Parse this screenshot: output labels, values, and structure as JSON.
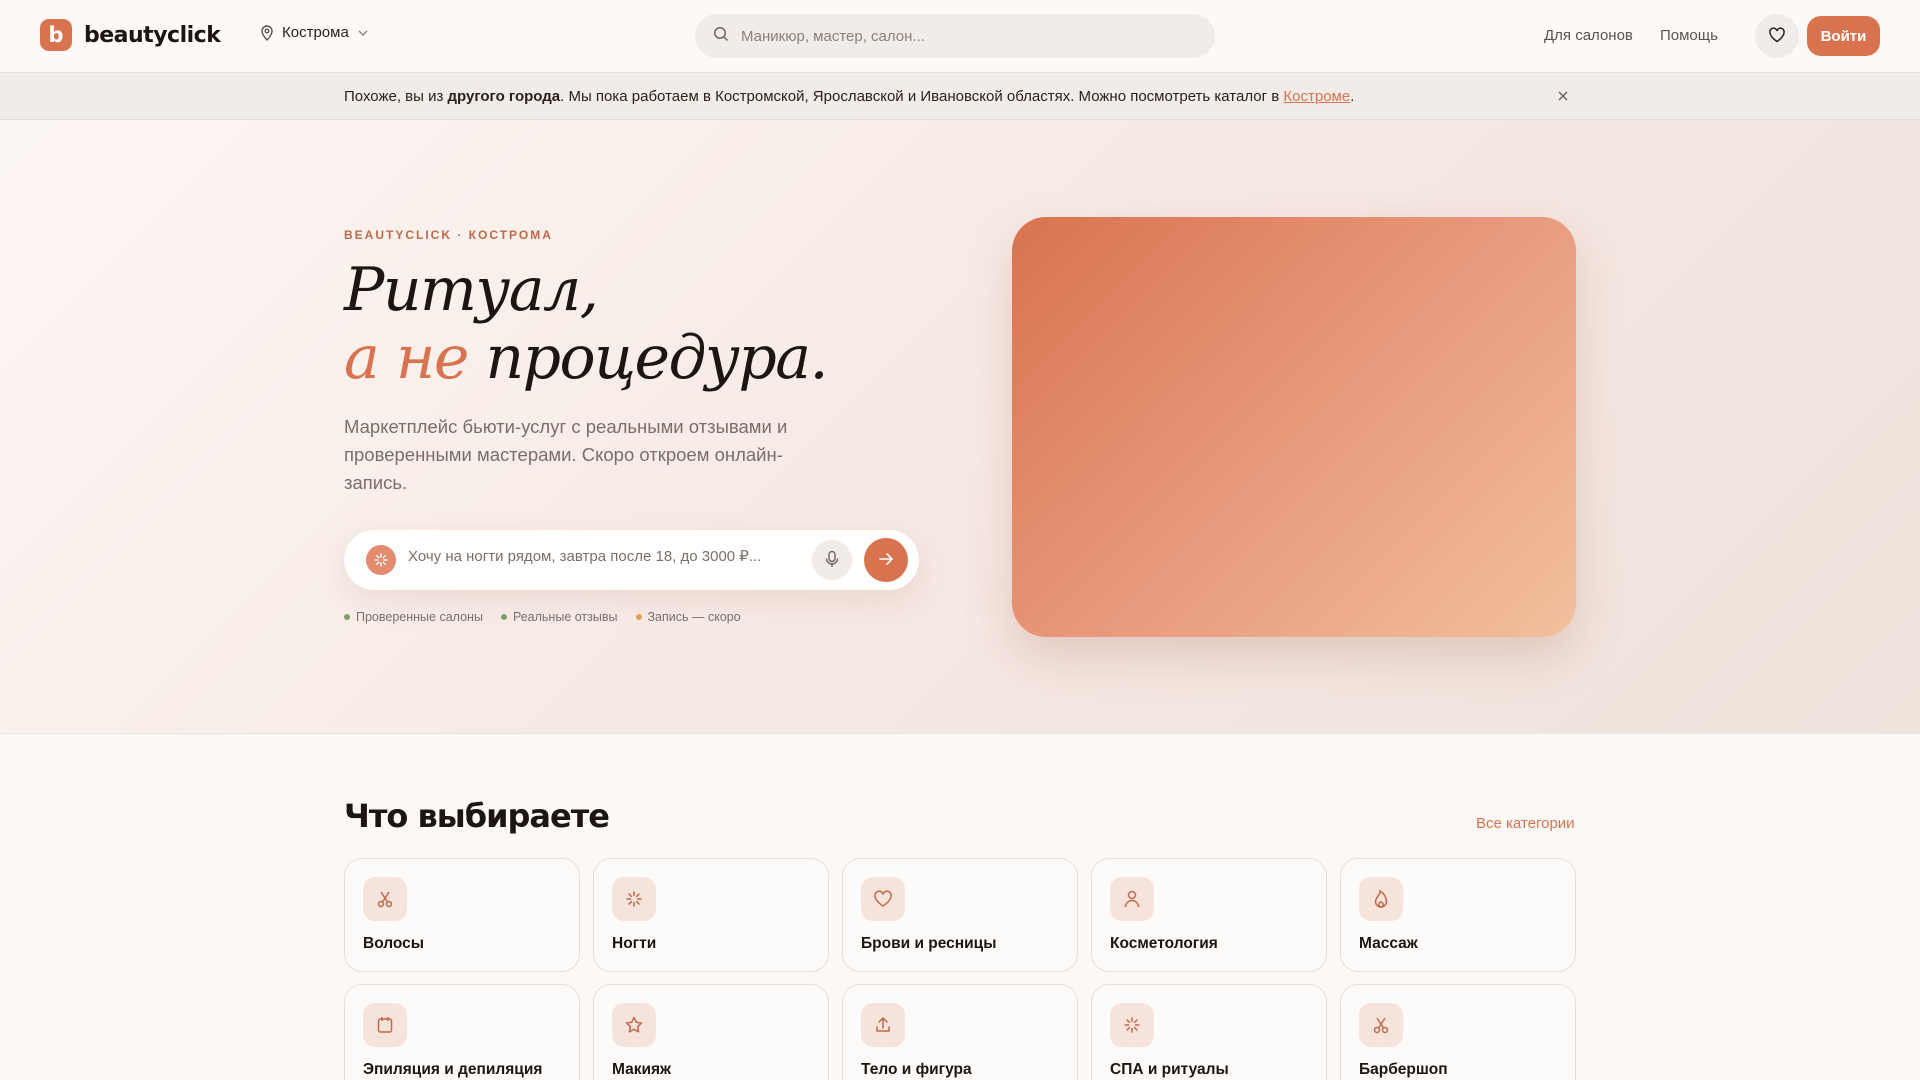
{
  "header": {
    "logo_mark": "b",
    "logo_text": "beautyclick",
    "city": "Кострома",
    "search_placeholder": "Маникюр, мастер, салон...",
    "links": [
      "Для салонов",
      "Помощь"
    ],
    "login_label": "Войти"
  },
  "notice": {
    "text_before": "Похоже, вы из ",
    "text_bold": "другого города",
    "text_after": ". Мы пока работаем в Костромской, Ярославской и Ивановской областях. Можно посмотреть каталог в ",
    "link": "Костроме",
    "text_end": "."
  },
  "hero": {
    "eyebrow": "BEAUTYCLICK · КОСТРОМА",
    "title_line1": "Ритуал,",
    "title_accent": "а не",
    "title_line2_rest": " процедура.",
    "subtitle": "Маркетплейс бьюти-услуг с реальными отзывами и проверенными мастерами. Скоро откроем онлайн-запись.",
    "ai_placeholder": "Хочу на ногти рядом, завтра после 18, до 3000 ₽...",
    "tags": [
      {
        "label": "Проверенные салоны",
        "color": "#7a9e6c"
      },
      {
        "label": "Реальные отзывы",
        "color": "#7a9e6c"
      },
      {
        "label": "Запись — скоро",
        "color": "#e0a24a"
      }
    ]
  },
  "categories": {
    "title": "Что выбираете",
    "all_link": "Все категории",
    "items": [
      {
        "label": "Волосы",
        "icon": "scissors-icon"
      },
      {
        "label": "Ногти",
        "icon": "sparkle-icon"
      },
      {
        "label": "Брови и ресницы",
        "icon": "heart-icon"
      },
      {
        "label": "Косметология",
        "icon": "person-icon"
      },
      {
        "label": "Массаж",
        "icon": "flame-icon"
      },
      {
        "label": "Эпиляция и депиляция",
        "icon": "calendar-icon"
      },
      {
        "label": "Макияж",
        "icon": "star-icon"
      },
      {
        "label": "Тело и фигура",
        "icon": "upload-icon"
      },
      {
        "label": "СПА и ритуалы",
        "icon": "sparkle-icon"
      },
      {
        "label": "Барбершоп",
        "icon": "scissors-icon"
      }
    ]
  },
  "colors": {
    "accent": "#d9734f",
    "background": "#fcf8f5",
    "text": "#1c1512"
  }
}
